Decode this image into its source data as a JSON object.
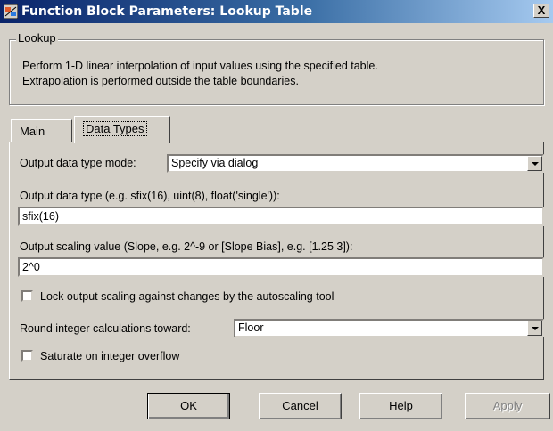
{
  "window": {
    "title": "Function Block Parameters: Lookup Table",
    "close_label": "X"
  },
  "lookup": {
    "group_title": "Lookup",
    "description_line1": "Perform 1-D linear interpolation of input values using the specified table.",
    "description_line2": "Extrapolation is performed outside the table boundaries."
  },
  "tabs": [
    {
      "label": "Main"
    },
    {
      "label": "Data Types",
      "selected": true
    }
  ],
  "form": {
    "output_mode_label": "Output data type mode:",
    "output_mode_value": "Specify via dialog",
    "output_type_label": "Output data type (e.g. sfix(16), uint(8), float('single')):",
    "output_type_value": "sfix(16)",
    "scaling_label": "Output scaling value (Slope, e.g. 2^-9 or [Slope Bias], e.g. [1.25 3]):",
    "scaling_value": "2^0",
    "lock_label": "Lock output scaling against changes by the autoscaling tool",
    "lock_checked": false,
    "round_label": "Round integer calculations toward:",
    "round_value": "Floor",
    "saturate_label": "Saturate on integer overflow",
    "saturate_checked": false
  },
  "buttons": {
    "ok": "OK",
    "cancel": "Cancel",
    "help": "Help",
    "apply": "Apply"
  },
  "colors": {
    "title_bar_start": "#0a246a",
    "title_bar_end": "#a6caf0",
    "face": "#d4d0c8"
  }
}
